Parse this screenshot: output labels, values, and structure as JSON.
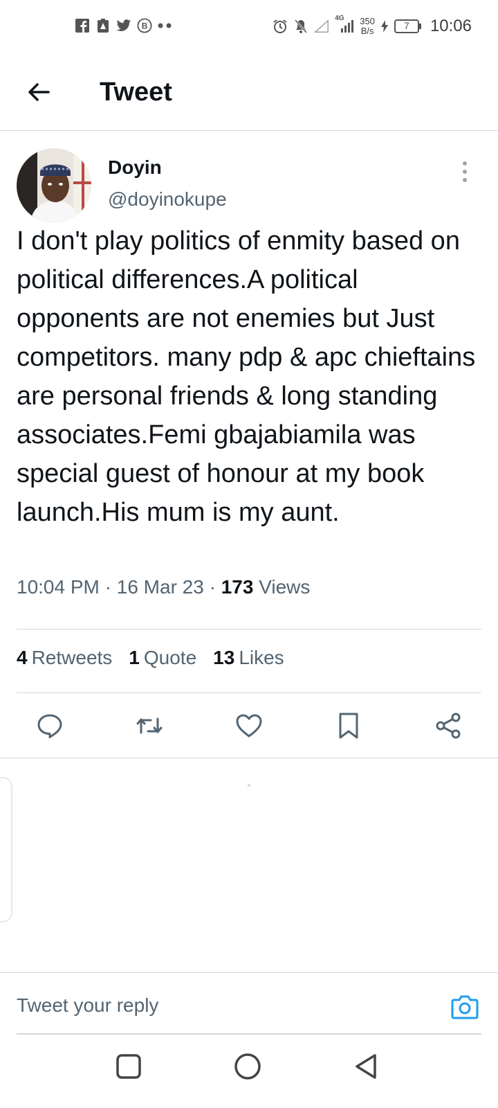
{
  "status_bar": {
    "left_icons": [
      "facebook-icon",
      "notification-alert-icon",
      "twitter-icon",
      "b-circle-icon",
      "more-dots-icon"
    ],
    "network_speed_value": "350",
    "network_speed_unit": "B/s",
    "network_type": "4G",
    "battery_level": "7",
    "time": "10:06"
  },
  "header": {
    "title": "Tweet"
  },
  "tweet": {
    "author_name": "Doyin",
    "author_handle": "@doyinokupe",
    "text": "I don't play politics of enmity based on political differences.A political opponents are not enemies but Just competitors. many pdp & apc chieftains are personal friends & long standing associates.Femi gbajabiamila was special guest of honour at my book launch.His mum is my aunt.",
    "time": "10:04 PM",
    "date": "16 Mar 23",
    "views_count": "173",
    "views_label": "Views",
    "separator": "·"
  },
  "stats": {
    "retweets_count": "4",
    "retweets_label": "Retweets",
    "quotes_count": "1",
    "quotes_label": "Quote",
    "likes_count": "13",
    "likes_label": "Likes"
  },
  "reply_bar": {
    "placeholder": "Tweet your reply"
  },
  "colors": {
    "text_primary": "#0f1419",
    "text_secondary": "#536471",
    "divider": "#cfd9de",
    "accent": "#1d9bf0"
  }
}
